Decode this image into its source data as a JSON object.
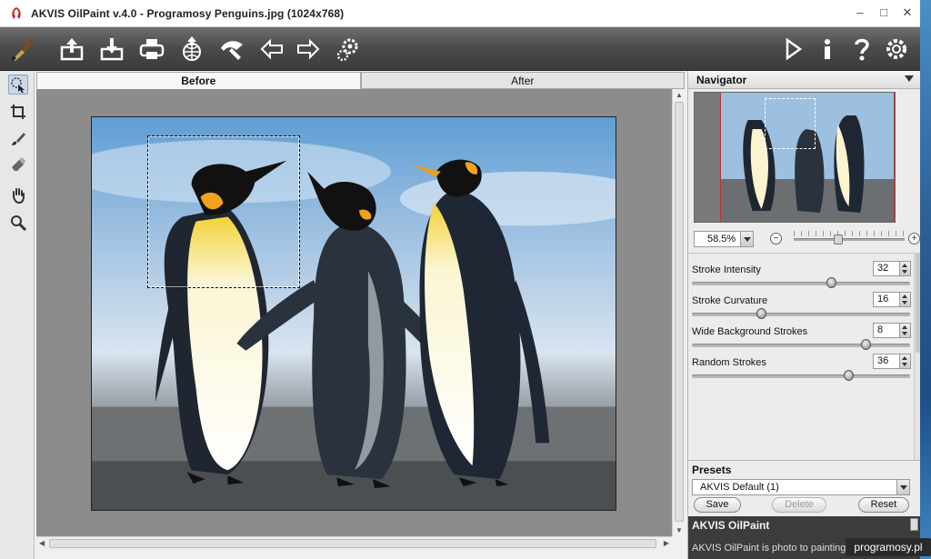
{
  "window": {
    "title": "AKVIS OilPaint v.4.0 - Programosy Penguins.jpg (1024x768)"
  },
  "window_controls": {
    "minimize": "–",
    "maximize": "□",
    "close": "✕"
  },
  "toolbar": {
    "left": [
      {
        "name": "brush-logo-icon"
      },
      {
        "name": "open-upload-icon"
      },
      {
        "name": "save-download-icon"
      },
      {
        "name": "print-icon"
      },
      {
        "name": "share-globe-icon"
      },
      {
        "name": "preferences-icon"
      },
      {
        "name": "undo-arrow-left-icon"
      },
      {
        "name": "redo-arrow-right-icon"
      },
      {
        "name": "batch-settings-icon"
      }
    ],
    "right": [
      {
        "name": "run-play-icon"
      },
      {
        "name": "info-icon"
      },
      {
        "name": "help-icon"
      },
      {
        "name": "settings-gear-icon"
      }
    ]
  },
  "tools": [
    "quick-select-icon",
    "crop-icon",
    "paint-brush-icon",
    "eraser-icon",
    "hand-icon",
    "zoom-icon"
  ],
  "tabs": {
    "before": "Before",
    "after": "After"
  },
  "navigator": {
    "title": "Navigator",
    "zoom": "58.5%",
    "zoom_minus": "−",
    "zoom_plus": "+",
    "zoom_level": 0.4
  },
  "params": [
    {
      "label": "Stroke Intensity",
      "value": "32",
      "slider": 0.64
    },
    {
      "label": "Stroke Curvature",
      "value": "16",
      "slider": 0.32
    },
    {
      "label": "Wide Background Strokes",
      "value": "8",
      "slider": 0.8
    },
    {
      "label": "Random Strokes",
      "value": "36",
      "slider": 0.72
    }
  ],
  "presets": {
    "title": "Presets",
    "selected": "AKVIS Default (1)",
    "save": "Save",
    "delete": "Delete",
    "reset": "Reset"
  },
  "help": {
    "title": "AKVIS OilPaint",
    "text": "AKVIS OilPaint is photo to painting so"
  },
  "watermark": "programosy.pl",
  "colors": {
    "toolbar": "#4a4a4a",
    "accent": "#b33333",
    "canvas_bg": "#8c8c8c"
  }
}
